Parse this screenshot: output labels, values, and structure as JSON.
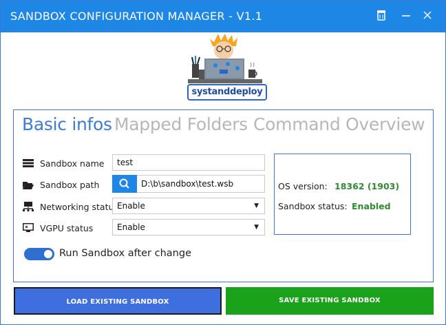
{
  "window": {
    "title": "SANDBOX CONFIGURATION MANAGER - V1.1"
  },
  "logo": {
    "text": "systanddeploy"
  },
  "tabs": [
    {
      "label": "Basic infos",
      "active": true
    },
    {
      "label": "Mapped Folders",
      "active": false
    },
    {
      "label": "Command",
      "active": false
    },
    {
      "label": "Overview",
      "active": false
    }
  ],
  "form": {
    "sandbox_name": {
      "label": "Sandbox name",
      "value": "test"
    },
    "sandbox_path": {
      "label": "Sandbox path",
      "value": "D:\\b\\sandbox\\test.wsb"
    },
    "networking": {
      "label": "Networking status",
      "value": "Enable"
    },
    "vgpu": {
      "label": "VGPU status",
      "value": "Enable"
    }
  },
  "info": {
    "os_label": "OS version:",
    "os_value": "18362 (1903)",
    "status_label": "Sandbox status:",
    "status_value": "Enabled"
  },
  "toggle": {
    "label": "Run Sandbox after change",
    "on": true
  },
  "buttons": {
    "load": "LOAD EXISTING SANDBOX",
    "save": "SAVE EXISTING SANDBOX"
  },
  "colors": {
    "titlebar": "#1e87e6",
    "accent": "#3c7bd6",
    "status_green": "#2e8b2e",
    "save_button": "#19a21a",
    "load_button": "#3f6fdf"
  }
}
